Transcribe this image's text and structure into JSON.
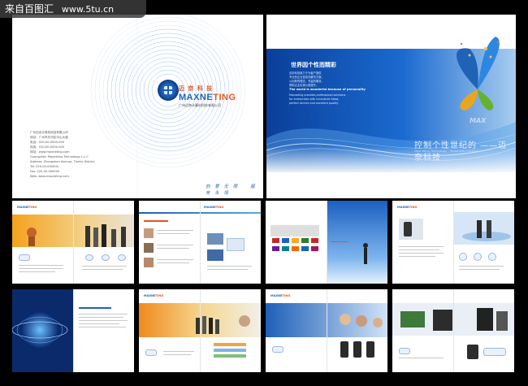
{
  "watermark": {
    "text": "来自百图汇",
    "site": "www.5tu.cn"
  },
  "cover": {
    "brand_cn": "迈 奈 科 技",
    "brand_en_a": "MAXNE",
    "brand_en_b": "TING",
    "brand_sub": "广州迈奈计算机科技有限公司",
    "address_lines": [
      "广州迈奈计算机科技有限公司",
      "地址：广州市天河区中山大道",
      "电话：020-00-0000-000",
      "传真：020-00-0000-000",
      "网址：www.maxneting.com",
      "",
      "Guangzhou Maxneting Technology L.L.C",
      "Address: Zhongshan Avenue, Tianhe District",
      "Tel: 020-00-000000",
      "Fax: 020-00-000000",
      "Web: www.maxneting.com"
    ],
    "slogans": [
      "创 意 无 限",
      "服 务 永 恒"
    ]
  },
  "spread_right": {
    "headline": "世界因个性而精彩",
    "lines": [
      "迈奈科技致力于为客户提供",
      "专业的企业信息化解决方案，",
      "以创新的理念，完善的服务，",
      "帮助企业实现价值提升。"
    ],
    "sub_en": "The world is wonderful because of personality",
    "lines2": [
      "Maxneting provides professional solutions",
      "for enterprises with innovative ideas,",
      "perfect service and excellent quality."
    ],
    "big_text": "控制个性世纪的  ——迈奈科技",
    "big_sub": "Maxneting Technology  ·  Personality Century",
    "watermark_mark": "MAX"
  },
  "thumbs": [
    {
      "logo_a": "MAXNE",
      "logo_b": "TING"
    },
    {
      "logo_a": "MAXNE",
      "logo_b": "TING"
    },
    {
      "logo_a": "",
      "logo_b": ""
    },
    {
      "logo_a": "MAXNE",
      "logo_b": "TING"
    },
    {
      "logo_a": "",
      "logo_b": ""
    },
    {
      "logo_a": "MAXNE",
      "logo_b": "TING"
    },
    {
      "logo_a": "MAXNE",
      "logo_b": "TING"
    },
    {
      "logo_a": "",
      "logo_b": ""
    }
  ]
}
